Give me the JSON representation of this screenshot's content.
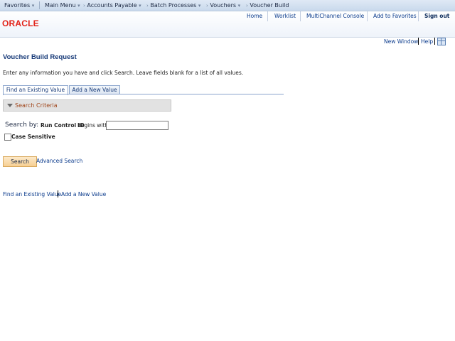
{
  "nav": {
    "favorites": "Favorites",
    "main_menu": "Main Menu",
    "crumbs": [
      "Accounts Payable",
      "Batch Processes",
      "Vouchers",
      "Voucher Build"
    ]
  },
  "header": {
    "logo": "ORACLE",
    "links": [
      "Home",
      "Worklist",
      "MultiChannel Console",
      "Add to Favorites"
    ],
    "signout": "Sign out"
  },
  "utility": {
    "new_window": "New Window",
    "help": "Help",
    "icon": "grid-icon"
  },
  "page": {
    "title": "Voucher Build Request",
    "instructions": "Enter any information you have and click Search. Leave fields blank for a list of all values."
  },
  "tabs": [
    "Find an Existing Value",
    "Add a New Value"
  ],
  "criteria": {
    "section_label": "Search Criteria",
    "search_by": "Search by:",
    "field": "Run Control ID",
    "operator": "begins with",
    "value": "",
    "case_sensitive": "Case Sensitive"
  },
  "actions": {
    "search": "Search",
    "advanced": "Advanced Search"
  },
  "bottom_links": [
    "Find an Existing Value",
    "Add a New Value"
  ],
  "colors": {
    "oracle_red": "#e2231a",
    "title_blue": "#173a78",
    "link_blue": "#0b3b8c",
    "criteria_text": "#a0461b",
    "search_button": "#f6cf93"
  }
}
